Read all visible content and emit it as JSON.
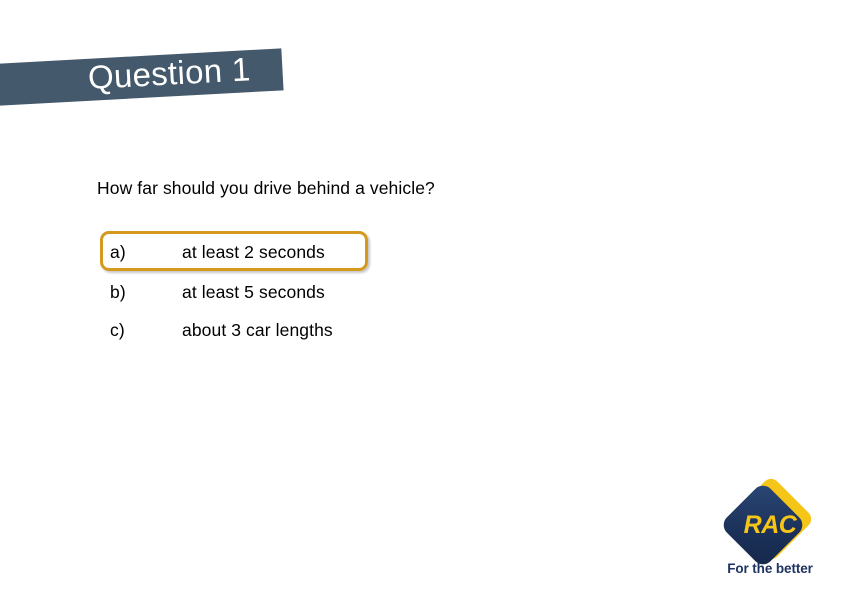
{
  "slide": {
    "title": "Question 1",
    "title_punctuation": ".",
    "background_color": "#ffffff",
    "banner_color": "#44596B"
  },
  "question": {
    "prompt": "How far should you drive behind a vehicle?",
    "options": [
      {
        "letter": "a)",
        "text": "at least 2 seconds",
        "selected": true
      },
      {
        "letter": "b)",
        "text": "at least 5 seconds",
        "selected": false
      },
      {
        "letter": "c)",
        "text": "about 3 car lengths",
        "selected": false
      }
    ],
    "highlight_color": "#D39A1F"
  },
  "logo": {
    "wordmark": "RAC",
    "tagline": "For the better",
    "navy": "#1D3461",
    "yellow": "#F5C518"
  }
}
